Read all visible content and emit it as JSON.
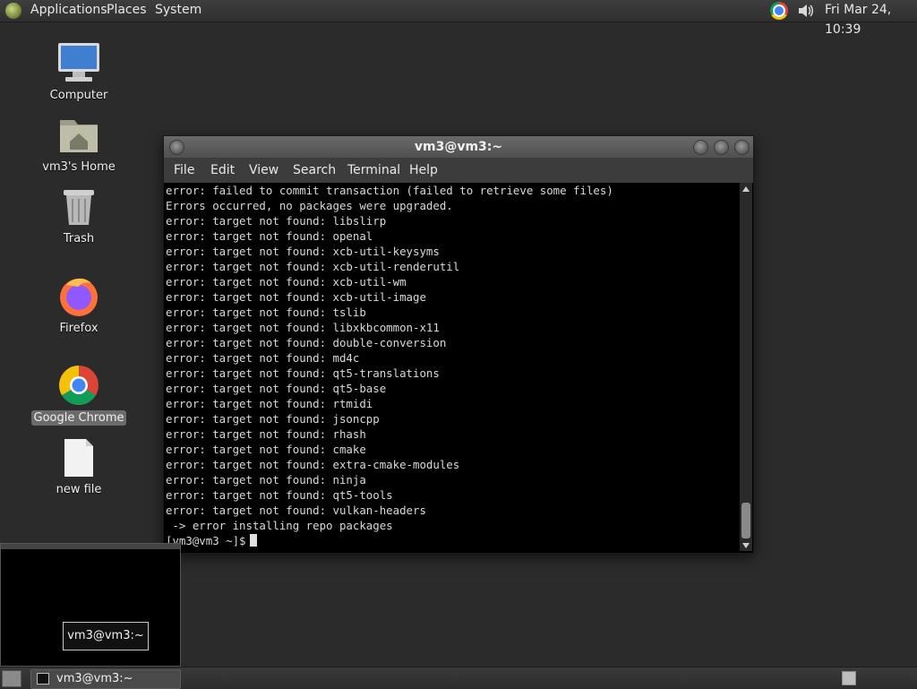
{
  "top_panel": {
    "menus": [
      "Applications",
      "Places",
      "System"
    ],
    "clock": "Fri Mar 24, 10:39"
  },
  "desktop": {
    "icons": [
      {
        "label": "Computer",
        "icon": "computer-icon"
      },
      {
        "label": "vm3's Home",
        "icon": "home-folder-icon"
      },
      {
        "label": "Trash",
        "icon": "trash-icon"
      },
      {
        "label": "Firefox",
        "icon": "firefox-icon"
      },
      {
        "label": "Google Chrome",
        "icon": "chrome-icon"
      },
      {
        "label": "new file",
        "icon": "file-icon"
      }
    ]
  },
  "terminal": {
    "title": "vm3@vm3:~",
    "menu": [
      "File",
      "Edit",
      "View",
      "Search",
      "Terminal",
      "Help"
    ],
    "lines": [
      "error: failed to commit transaction (failed to retrieve some files)",
      "Errors occurred, no packages were upgraded.",
      "error: target not found: libslirp",
      "error: target not found: openal",
      "error: target not found: xcb-util-keysyms",
      "error: target not found: xcb-util-renderutil",
      "error: target not found: xcb-util-wm",
      "error: target not found: xcb-util-image",
      "error: target not found: tslib",
      "error: target not found: libxkbcommon-x11",
      "error: target not found: double-conversion",
      "error: target not found: md4c",
      "error: target not found: qt5-translations",
      "error: target not found: qt5-base",
      "error: target not found: rtmidi",
      "error: target not found: jsoncpp",
      "error: target not found: rhash",
      "error: target not found: cmake",
      "error: target not found: extra-cmake-modules",
      "error: target not found: ninja",
      "error: target not found: qt5-tools",
      "error: target not found: vulkan-headers",
      " -> error installing repo packages"
    ],
    "prompt": "[vm3@vm3 ~]$"
  },
  "preview": {
    "label": "vm3@vm3:~"
  },
  "taskbar": {
    "task_label": "vm3@vm3:~"
  }
}
